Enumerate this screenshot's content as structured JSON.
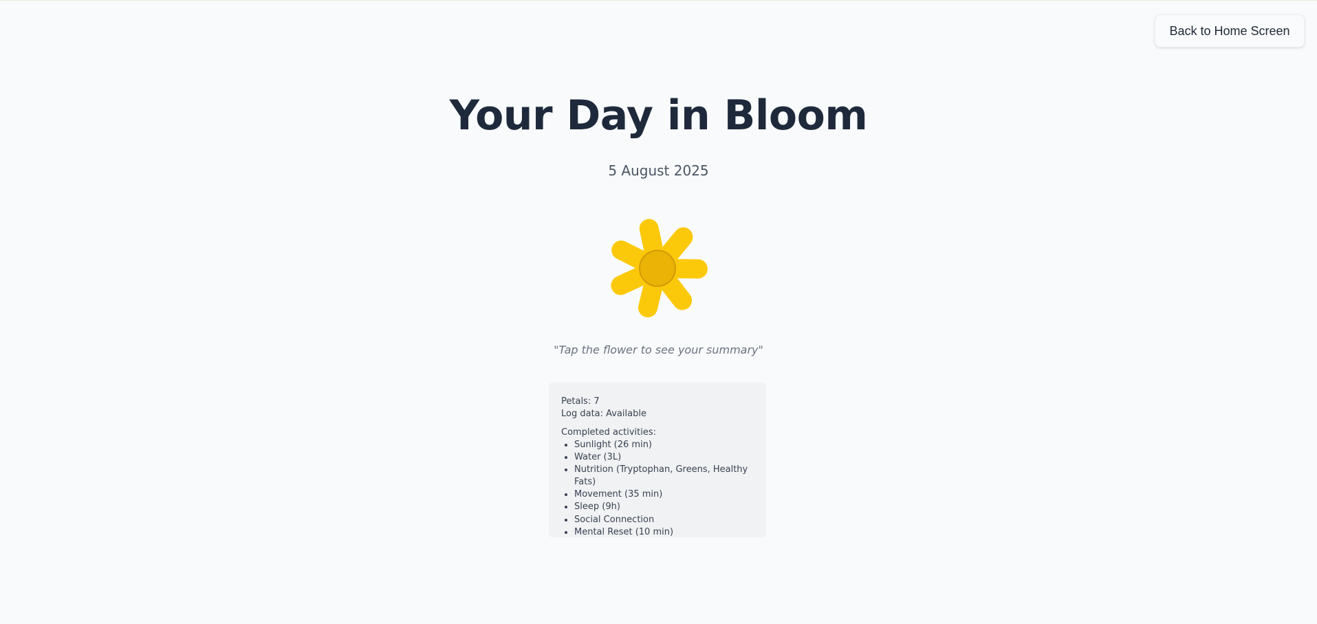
{
  "header": {
    "back_label": "Back to Home Screen"
  },
  "main": {
    "title": "Your Day in Bloom",
    "date": "5 August 2025",
    "hint": "\"Tap the flower to see your summary\""
  },
  "flower": {
    "petal_count": 7,
    "petal_color": "#fcc90a",
    "center_color": "#eab305",
    "center_border": "#d29a06"
  },
  "summary": {
    "petals_label": "Petals: 7",
    "log_label": "Log data: Available",
    "activities_title": "Completed activities:",
    "activities": [
      "Sunlight (26 min)",
      "Water (3L)",
      "Nutrition (Tryptophan, Greens, Healthy Fats)",
      "Movement (35 min)",
      "Sleep (9h)",
      "Social Connection",
      "Mental Reset (10 min)"
    ]
  }
}
